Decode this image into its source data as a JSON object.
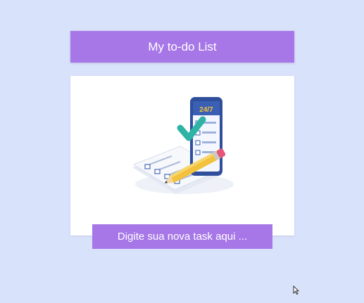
{
  "header": {
    "title": "My to-do List"
  },
  "illustration": {
    "icon": "todo-checklist-phone-pencil-illustration",
    "phone_label": "24/7"
  },
  "task_input": {
    "placeholder": "Digite sua nova task aqui ...",
    "value": ""
  },
  "colors": {
    "page_background": "#d9e2fb",
    "accent_purple": "#a777e8",
    "card_background": "#ffffff",
    "phone_blue": "#2f4f9c",
    "check_teal": "#2fb3a4",
    "pencil_yellow": "#f3c23c",
    "eraser_pink": "#e8557a"
  }
}
